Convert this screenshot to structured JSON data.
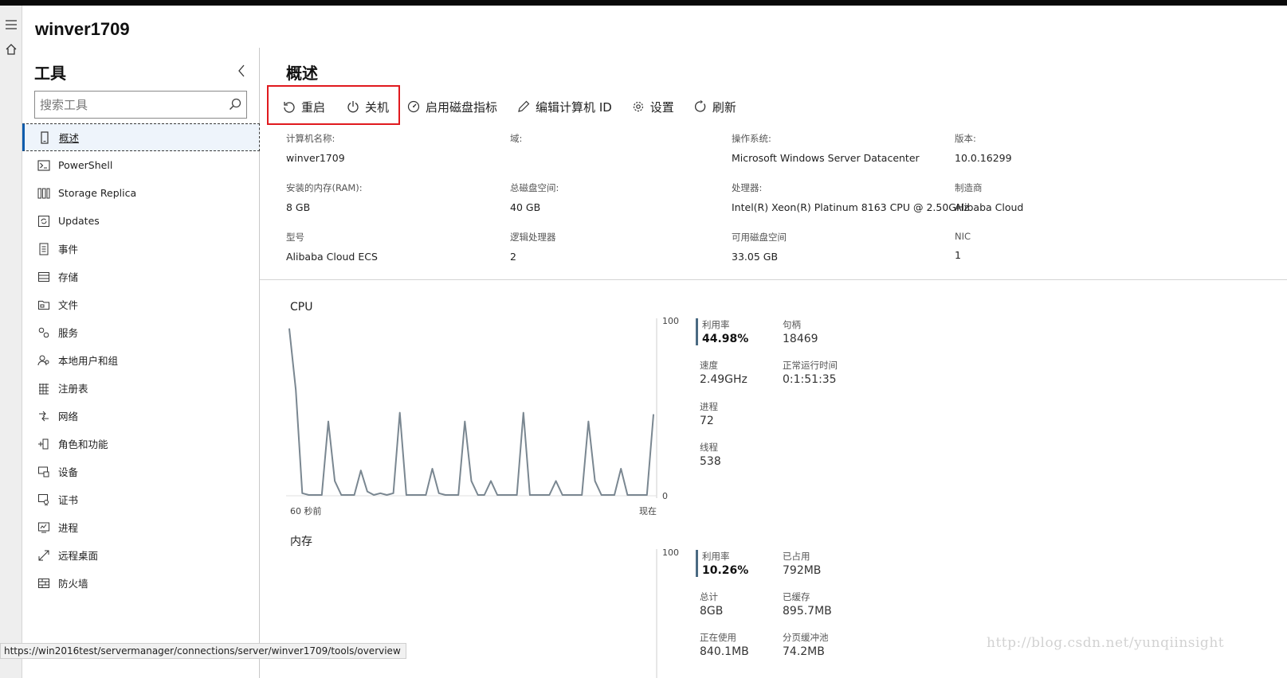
{
  "app": {
    "server_name": "winver1709"
  },
  "rail": {
    "menu_icon": "hamburger-icon",
    "home_icon": "home-icon"
  },
  "sidebar": {
    "title": "工具",
    "search_placeholder": "搜索工具",
    "items": [
      {
        "label": "概述",
        "icon": "overview-icon",
        "active": true
      },
      {
        "label": "PowerShell",
        "icon": "powershell-icon"
      },
      {
        "label": "Storage Replica",
        "icon": "storage-replica-icon"
      },
      {
        "label": "Updates",
        "icon": "updates-icon"
      },
      {
        "label": "事件",
        "icon": "events-icon"
      },
      {
        "label": "存储",
        "icon": "storage-icon"
      },
      {
        "label": "文件",
        "icon": "files-icon"
      },
      {
        "label": "服务",
        "icon": "services-icon"
      },
      {
        "label": "本地用户和组",
        "icon": "users-icon"
      },
      {
        "label": "注册表",
        "icon": "registry-icon"
      },
      {
        "label": "网络",
        "icon": "network-icon"
      },
      {
        "label": "角色和功能",
        "icon": "roles-icon"
      },
      {
        "label": "设备",
        "icon": "devices-icon"
      },
      {
        "label": "证书",
        "icon": "certificates-icon"
      },
      {
        "label": "进程",
        "icon": "processes-icon"
      },
      {
        "label": "远程桌面",
        "icon": "remote-desktop-icon"
      },
      {
        "label": "防火墙",
        "icon": "firewall-icon"
      }
    ]
  },
  "main": {
    "title": "概述",
    "toolbar": {
      "restart": "重启",
      "shutdown": "关机",
      "disk_metrics": "启用磁盘指标",
      "edit_computer_id": "编辑计算机 ID",
      "settings": "设置",
      "refresh": "刷新"
    },
    "properties": [
      {
        "label": "计算机名称:",
        "value": "winver1709"
      },
      {
        "label": "域:",
        "value": ""
      },
      {
        "label": "操作系统:",
        "value": "Microsoft Windows Server Datacenter"
      },
      {
        "label": "版本:",
        "value": "10.0.16299"
      },
      {
        "label": "安装的内存(RAM):",
        "value": "8 GB"
      },
      {
        "label": "总磁盘空间:",
        "value": "40 GB"
      },
      {
        "label": "处理器:",
        "value": "Intel(R) Xeon(R) Platinum 8163 CPU @ 2.50GHz"
      },
      {
        "label": "制造商",
        "value": "Alibaba Cloud"
      },
      {
        "label": "型号",
        "value": "Alibaba Cloud ECS"
      },
      {
        "label": "逻辑处理器",
        "value": "2"
      },
      {
        "label": "可用磁盘空间",
        "value": "33.05 GB"
      },
      {
        "label": "NIC",
        "value": "1"
      }
    ],
    "cpu": {
      "title": "CPU",
      "y_max_label": "100",
      "y_min_label": "0",
      "x_start_label": "60 秒前",
      "x_end_label": "现在",
      "stats": {
        "utilization": {
          "label": "利用率",
          "value": "44.98%"
        },
        "handles": {
          "label": "句柄",
          "value": "18469"
        },
        "speed": {
          "label": "速度",
          "value": "2.49GHz"
        },
        "uptime": {
          "label": "正常运行时间",
          "value": "0:1:51:35"
        },
        "processes": {
          "label": "进程",
          "value": "72"
        },
        "threads": {
          "label": "线程",
          "value": "538"
        }
      }
    },
    "memory": {
      "title": "内存",
      "y_max_label": "100",
      "stats": {
        "utilization": {
          "label": "利用率",
          "value": "10.26%"
        },
        "in_use": {
          "label": "已占用",
          "value": "792MB"
        },
        "total": {
          "label": "总计",
          "value": "8GB"
        },
        "cached": {
          "label": "已缓存",
          "value": "895.7MB"
        },
        "active": {
          "label": "正在使用",
          "value": "840.1MB"
        },
        "paged_pool": {
          "label": "分页缓冲池",
          "value": "74.2MB"
        }
      }
    }
  },
  "chart_data": {
    "type": "line",
    "title": "CPU",
    "xlabel": "",
    "ylabel": "",
    "ylim": [
      0,
      100
    ],
    "x_labels": [
      "60 秒前",
      "现在"
    ],
    "series": [
      {
        "values": [
          95,
          60,
          1,
          0,
          0,
          0,
          42,
          8,
          0,
          0,
          0,
          14,
          2,
          0,
          1,
          0,
          1,
          47,
          0,
          0,
          0,
          0,
          15,
          1,
          0,
          0,
          0,
          42,
          8,
          0,
          0,
          8,
          0,
          0,
          0,
          0,
          47,
          0,
          0,
          0,
          0,
          8,
          0,
          0,
          0,
          0,
          42,
          8,
          0,
          0,
          0,
          15,
          0,
          0,
          0,
          0,
          46
        ]
      }
    ],
    "color": "#7a8791",
    "grid": false
  },
  "statusbar": {
    "url": "https://win2016test/servermanager/connections/server/winver1709/tools/overview"
  },
  "watermark": {
    "text": "http://blog.csdn.net/yunqiinsight"
  }
}
